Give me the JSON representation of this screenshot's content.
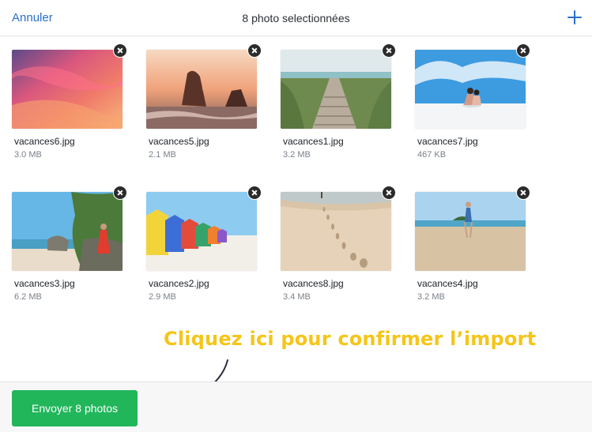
{
  "header": {
    "cancel_label": "Annuler",
    "title": "8 photo selectionnées",
    "add_icon": "plus-icon"
  },
  "photos": [
    {
      "name": "vacances6.jpg",
      "size": "3.0 MB",
      "scene": "sunset-sky"
    },
    {
      "name": "vacances5.jpg",
      "size": "2.1 MB",
      "scene": "sunset-rocks"
    },
    {
      "name": "vacances1.jpg",
      "size": "3.2 MB",
      "scene": "boardwalk"
    },
    {
      "name": "vacances7.jpg",
      "size": "467 KB",
      "scene": "beach-couple"
    },
    {
      "name": "vacances3.jpg",
      "size": "6.2 MB",
      "scene": "red-dress-rock"
    },
    {
      "name": "vacances2.jpg",
      "size": "2.9 MB",
      "scene": "beach-huts"
    },
    {
      "name": "vacances8.jpg",
      "size": "3.4 MB",
      "scene": "footprints"
    },
    {
      "name": "vacances4.jpg",
      "size": "3.2 MB",
      "scene": "island-beach"
    }
  ],
  "remove_icon": "close-icon",
  "callout": "Cliquez ici pour confirmer l’import",
  "footer": {
    "send_label": "Envoyer 8 photos"
  },
  "colors": {
    "accent": "#2a6fc9",
    "send_button": "#21b65a",
    "callout": "#f5c518"
  }
}
